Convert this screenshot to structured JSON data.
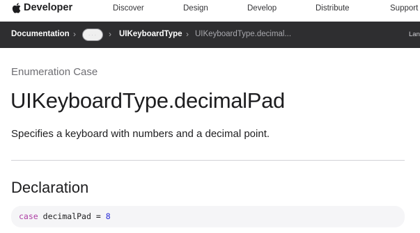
{
  "globalnav": {
    "brand_label": "Developer",
    "links": [
      "Discover",
      "Design",
      "Develop",
      "Distribute",
      "Support"
    ]
  },
  "breadcrumb": {
    "root": "Documentation",
    "ellipsis": "···",
    "parent": "UIKeyboardType",
    "current": "UIKeyboardType.decimal..."
  },
  "language_toggle": "Lan",
  "page": {
    "eyebrow": "Enumeration Case",
    "title": "UIKeyboardType.decimalPad",
    "abstract": "Specifies a keyboard with numbers and a decimal point."
  },
  "declaration": {
    "heading": "Declaration",
    "keyword": "case",
    "name": "decimalPad",
    "operator": "=",
    "value": "8"
  },
  "colors": {
    "breadcrumb_background": "#2e2e30",
    "code_background": "#f5f5f7",
    "code_keyword": "#ad3da4",
    "code_number": "#272ad8"
  }
}
